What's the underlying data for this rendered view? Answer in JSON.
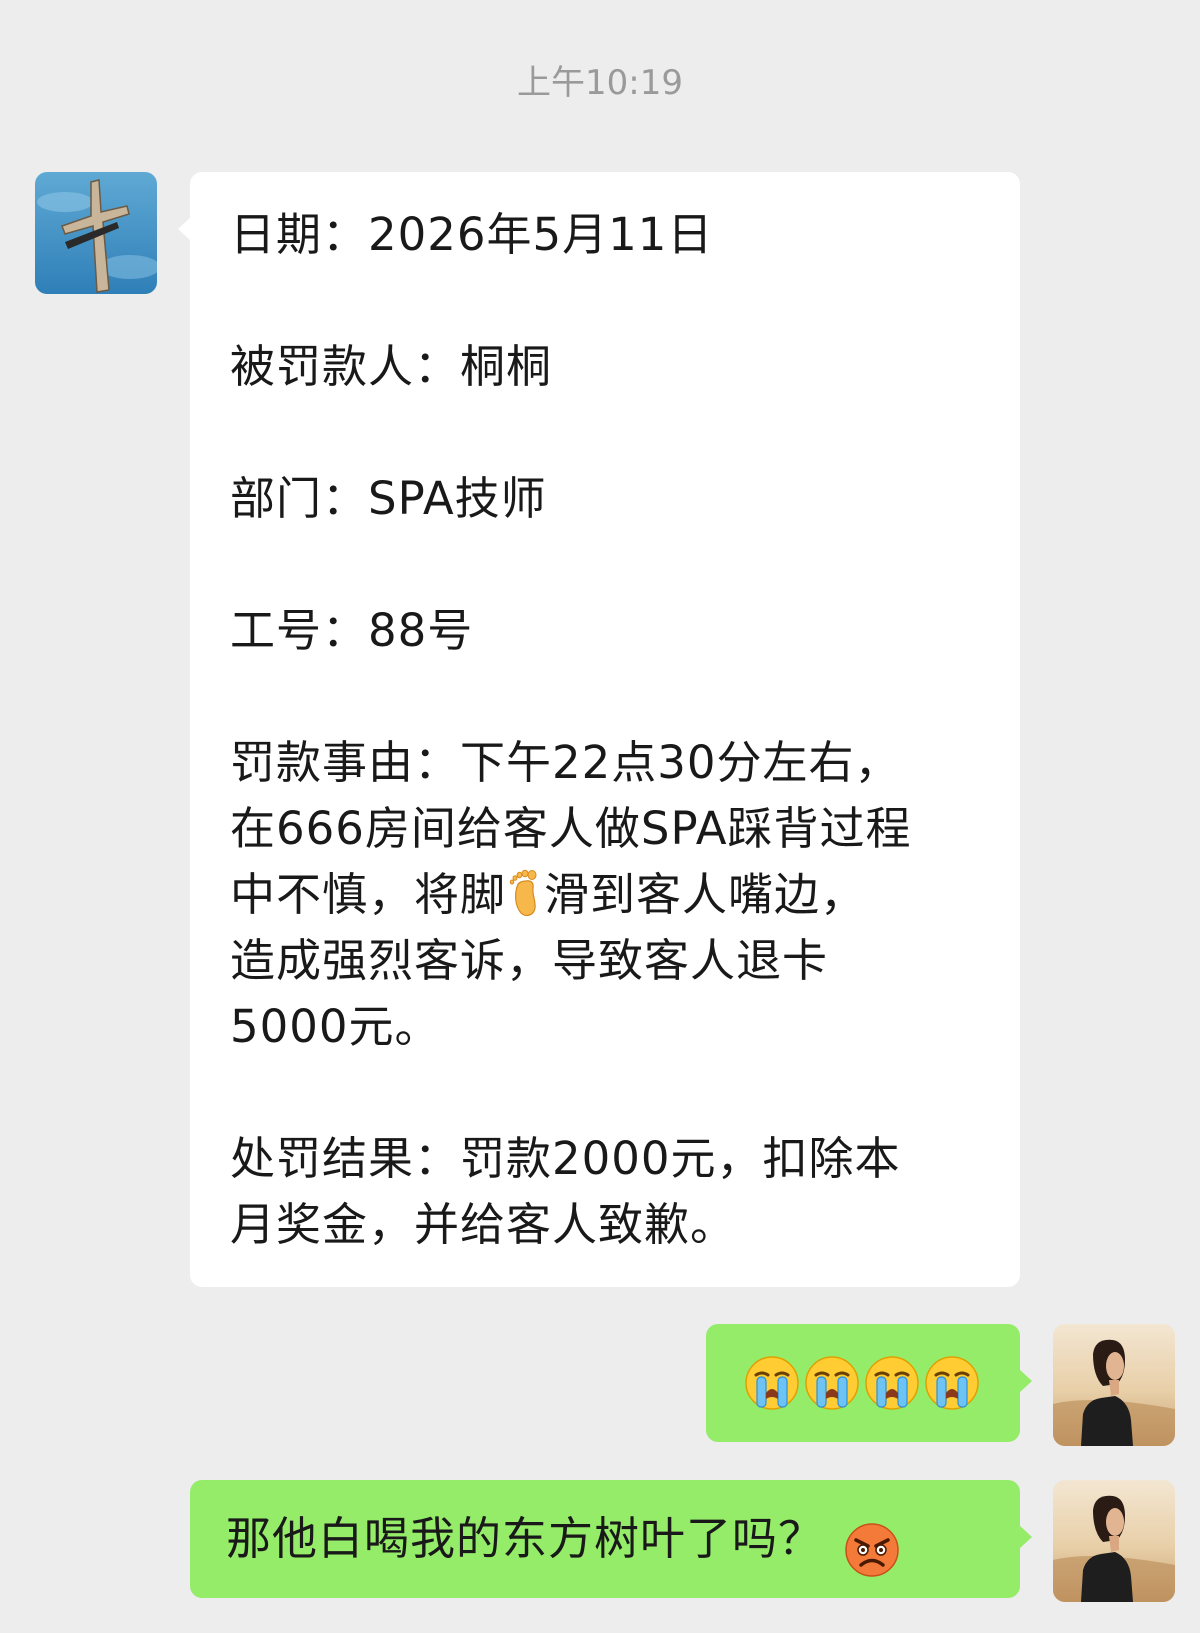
{
  "chat": {
    "timestamp": "上午10:19",
    "incoming": {
      "avatar_icon": "cross-statue-sky-avatar",
      "lines": [
        "日期：2026年5月11日",
        "被罚款人：桐桐",
        "部门：SPA技师",
        "工号：88号",
        "罚款事由：下午22点30分左右，",
        "在666房间给客人做SPA踩背过程",
        "中不慎，将脚",
        "滑到客人嘴边，",
        "造成强烈客诉，导致客人退卡",
        "5000元。",
        "处罚结果：罚款2000元，扣除本",
        "月奖金，并给客人致歉。"
      ],
      "inline_icon": "foot-emoji"
    },
    "outgoing_1": {
      "avatar_icon": "woman-desert-avatar",
      "emoji_icons": [
        "loudly-crying-emoji",
        "loudly-crying-emoji",
        "loudly-crying-emoji",
        "loudly-crying-emoji"
      ]
    },
    "outgoing_2": {
      "avatar_icon": "woman-desert-avatar",
      "text": "那他白喝我的东方树叶了吗？",
      "emoji_icon": "angry-face-emoji"
    },
    "colors": {
      "background": "#ededed",
      "incoming_bubble": "#ffffff",
      "outgoing_bubble": "#95ec69",
      "timestamp_text": "#9a9a9a"
    }
  }
}
